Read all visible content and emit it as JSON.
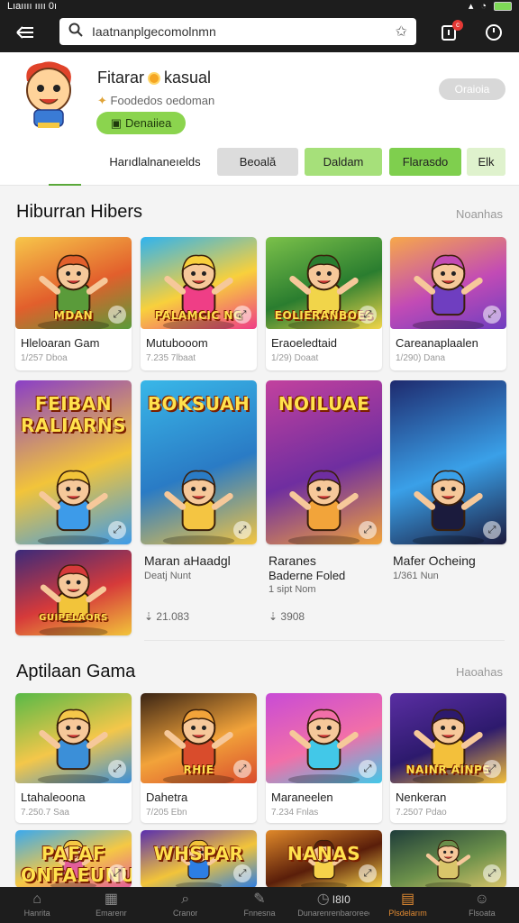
{
  "status": {
    "left": "Lıaıııı ıııı 0ı",
    "right_icons": [
      "signal-icon",
      "wifi-icon",
      "battery-icon"
    ]
  },
  "topbar": {
    "search_value": "Iaatnanplgecomolnmn",
    "icons": [
      "back-arrow-icon",
      "search-icon",
      "star-icon",
      "notification-icon",
      "clock-icon"
    ],
    "notification_badge": "c"
  },
  "profile": {
    "name": "Fitarar",
    "name_suffix": "kasual",
    "subtitle": "Foodedos oedoman",
    "level_button": "Denaiiea",
    "follow_button": "Oraioia"
  },
  "tabs": [
    {
      "label": "Harıdlalnaneıelds",
      "active": true
    },
    {
      "label": "Beoală"
    },
    {
      "label": "Daldam"
    },
    {
      "label": "Flarasdo"
    },
    {
      "label": "Elk"
    }
  ],
  "section1": {
    "title": "Hiburran Hibers",
    "more": "Noanhas",
    "cards": [
      {
        "name": "Hleloaran Gam",
        "meta": "1/257 Dboa",
        "thumb_text": "MDAN",
        "colors": [
          "#f7c64a",
          "#e25f2c",
          "#5a9b3a"
        ]
      },
      {
        "name": "Mutubooom",
        "meta": "7.235 7lbaat",
        "thumb_text": "PALAMCIC NG",
        "colors": [
          "#2fb3f0",
          "#f8d03c",
          "#ef3e86"
        ]
      },
      {
        "name": "Eraoeledtaid",
        "meta": "1/29) Doaat",
        "thumb_text": "EOLIERANBOES",
        "colors": [
          "#7bc14a",
          "#2a7d2f",
          "#f1d54a"
        ]
      },
      {
        "name": "Careanaplaalen",
        "meta": "1/290) Dana",
        "thumb_text": "",
        "colors": [
          "#f7a84a",
          "#c24bb5",
          "#6f3ec0"
        ]
      }
    ],
    "tall_cards": [
      {
        "thumb_text": "FEIBAN RALIARNS",
        "colors": [
          "#8a3fc7",
          "#f2c43a",
          "#3d9be9"
        ]
      },
      {
        "thumb_text": "BOKSUAH",
        "colors": [
          "#39b7e8",
          "#2a7bc5",
          "#f4c542"
        ]
      },
      {
        "thumb_text": "NOILUAE",
        "colors": [
          "#c2419e",
          "#6f2ea0",
          "#f2a43a"
        ]
      },
      {
        "thumb_text": "",
        "colors": [
          "#1e2a6e",
          "#3aa0e8",
          "#1b1b3d"
        ]
      }
    ],
    "small_card": {
      "thumb_text": "GUIPELAORS",
      "colors": [
        "#3b2a7a",
        "#d63a3a",
        "#f2c43a"
      ]
    },
    "list_items": [
      {
        "name": "Maran aHaadgl",
        "meta": "Deatj Nunt",
        "stat": "21.083"
      },
      {
        "name": "Raranes",
        "name2": "Baderne Foled",
        "meta": "1 sipt Nom",
        "stat": "3908"
      },
      {
        "name": "Mafer Ocheing",
        "meta": "1/361 Nun"
      }
    ]
  },
  "section2": {
    "title": "Aptilaan Gama",
    "more": "Haoahas",
    "cards": [
      {
        "name": "Ltahaleoona",
        "meta": "7.250.7 Saa",
        "thumb_text": "",
        "colors": [
          "#58b947",
          "#f4c74a",
          "#3b8fd8"
        ]
      },
      {
        "name": "Dahetra",
        "meta": "7/205 Ebn",
        "thumb_text": "RHIE",
        "colors": [
          "#3a2414",
          "#f2a33a",
          "#d94c2c"
        ]
      },
      {
        "name": "Maraneelen",
        "meta": "7.234 Fnlas",
        "thumb_text": "",
        "colors": [
          "#c84bd6",
          "#f26fa8",
          "#42c8e8"
        ]
      },
      {
        "name": "Nenkeran",
        "meta": "7.2507 Pdao",
        "thumb_text": "NAINR AINPS",
        "colors": [
          "#5a2ea3",
          "#2d1a6d",
          "#f3c03b"
        ]
      }
    ],
    "bottom_cards": [
      {
        "thumb_text": "PAFAF ONFAEUNUS",
        "colors": [
          "#3aa9ef",
          "#f5c844",
          "#e25e9a"
        ]
      },
      {
        "thumb_text": "WHSPAR",
        "colors": [
          "#5a2fae",
          "#f2c43a",
          "#2d7ee3"
        ]
      },
      {
        "thumb_text": "NANAS",
        "colors": [
          "#e0892a",
          "#5a1e0a",
          "#f6d24a"
        ]
      },
      {
        "thumb_text": "",
        "colors": [
          "#1f3d3a",
          "#6a8f4a",
          "#d9c56a"
        ]
      }
    ]
  },
  "bottom_nav": [
    {
      "label": "Hanrita",
      "icon": "home-icon"
    },
    {
      "label": "Emarenr",
      "icon": "store-icon"
    },
    {
      "label": "Cranor",
      "icon": "search-icon"
    },
    {
      "label": "Fnnesna",
      "icon": "games-icon"
    },
    {
      "label": "Dunarenrenbaroreee",
      "icon": "clock-icon",
      "extra": "I8I0"
    },
    {
      "label": "Plsdelarım",
      "icon": "library-icon",
      "active": true
    },
    {
      "label": "Flsoata",
      "icon": "profile-icon"
    }
  ]
}
